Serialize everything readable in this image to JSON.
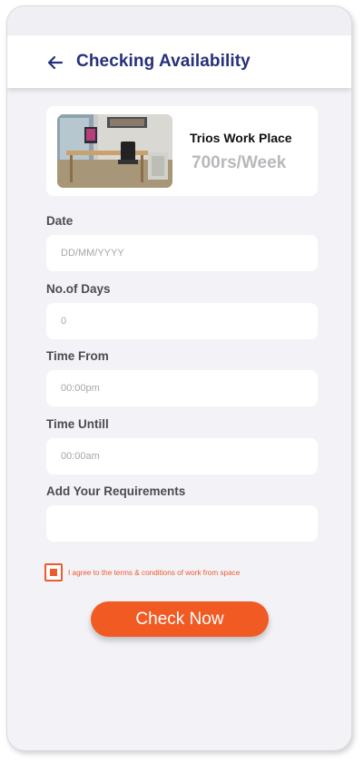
{
  "header": {
    "title": "Checking Availability",
    "back_icon": "back-arrow-icon",
    "accent_color": "#27307a"
  },
  "workspace": {
    "name": "Trios Work Place",
    "price": "700rs/Week",
    "image": "office-desk-photo"
  },
  "form": {
    "date": {
      "label": "Date",
      "value": "",
      "placeholder": "DD/MM/YYYY"
    },
    "days": {
      "label": "No.of Days",
      "value": "",
      "placeholder": "0"
    },
    "time_from": {
      "label": "Time From",
      "value": "",
      "placeholder": "00:00pm"
    },
    "time_until": {
      "label": "Time Untill",
      "value": "",
      "placeholder": "00:00am"
    },
    "requirements": {
      "label": "Add Your Requirements",
      "value": "",
      "placeholder": ""
    }
  },
  "terms": {
    "text": "I agree to the terms & conditions of work from space",
    "checked": true,
    "color": "#ee5a2c"
  },
  "cta": {
    "label": "Check Now",
    "color": "#f25a24"
  }
}
